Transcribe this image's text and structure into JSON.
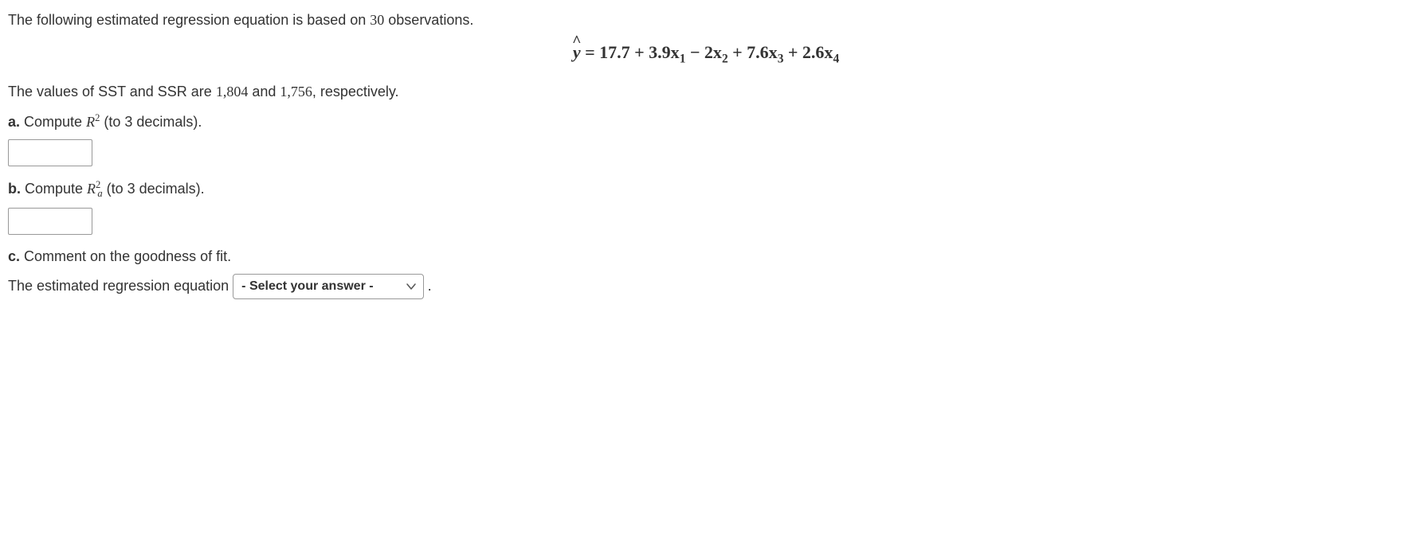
{
  "intro": {
    "part1": "The following estimated regression equation is based on ",
    "observations": "30",
    "part2": " observations."
  },
  "equation": {
    "lhs_var": "y",
    "rhs": " = 17.7 + 3.9x",
    "sub1": "1",
    "rhs2": " − 2x",
    "sub2": "2",
    "rhs3": " + 7.6x",
    "sub3": "3",
    "rhs4": " + 2.6x",
    "sub4": "4"
  },
  "sst_line": {
    "part1": "The values of SST and SSR are ",
    "sst": "1,804",
    "part2": " and ",
    "ssr": "1,756",
    "part3": ", respectively."
  },
  "qa": {
    "label": "a.",
    "text": " Compute ",
    "r": "R",
    "exp": "2",
    "after": " (to 3 decimals)."
  },
  "qb": {
    "label": "b.",
    "text": " Compute ",
    "r": "R",
    "exp": "2",
    "sub": "a",
    "after": " (to 3 decimals)."
  },
  "qc": {
    "label": "c.",
    "text": " Comment on the goodness of fit."
  },
  "answer_line": {
    "prefix": "The estimated regression equation ",
    "select_placeholder": "- Select your answer -",
    "suffix": " ."
  }
}
